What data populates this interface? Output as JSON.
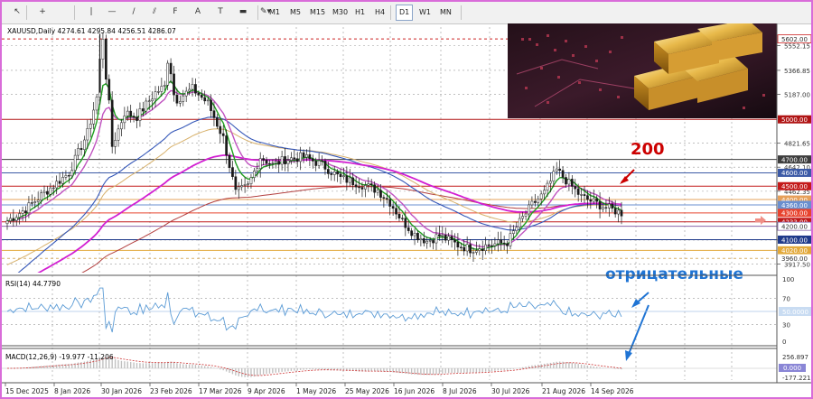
{
  "toolbar": {
    "tools": [
      {
        "name": "cursor",
        "glyph": "↖"
      },
      {
        "name": "crosshair",
        "glyph": "+"
      },
      {
        "name": "vertical-line",
        "glyph": "|"
      },
      {
        "name": "horizontal-line",
        "glyph": "—"
      },
      {
        "name": "trendline",
        "glyph": "/"
      },
      {
        "name": "equidistant-channel",
        "glyph": "⫽"
      },
      {
        "name": "fibonacci",
        "glyph": "F"
      },
      {
        "name": "text",
        "glyph": "A"
      },
      {
        "name": "text-label",
        "glyph": "T"
      },
      {
        "name": "rectangle",
        "glyph": "▬"
      },
      {
        "name": "shapes",
        "glyph": "✎▾"
      }
    ],
    "timeframes": [
      "M1",
      "M5",
      "M15",
      "M30",
      "H1",
      "H4",
      "D1",
      "W1",
      "MN"
    ],
    "active_timeframe": "D1"
  },
  "chart_info": {
    "symbol_line": "XAUUSD,Daily  4274.61 4295.84 4256.51 4286.07"
  },
  "annotations": {
    "ma_label": "200",
    "rsi_note": "отрицательные"
  },
  "price_axis": {
    "ticks": [
      "5552.15",
      "5366.85",
      "5187.00",
      "4821.65",
      "4642.10",
      "4462.35",
      "4097.40",
      "3917.50"
    ],
    "levels": [
      {
        "label": "5602.00",
        "bg": "#ffffff",
        "fg": "#333333",
        "border": "#cc2222",
        "price": 5602
      },
      {
        "label": "5000.00",
        "bg": "#b01414",
        "fg": "#ffffff",
        "price": 5000
      },
      {
        "label": "4700.00",
        "bg": "#3d3d3d",
        "fg": "#ffffff",
        "price": 4700
      },
      {
        "label": "4600.00",
        "bg": "#3c5aa6",
        "fg": "#ffffff",
        "price": 4600
      },
      {
        "label": "4500.00",
        "bg": "#c41a1a",
        "fg": "#ffffff",
        "price": 4500
      },
      {
        "label": "4400.00",
        "bg": "#e6a05a",
        "fg": "#ffffff",
        "price": 4400
      },
      {
        "label": "4360.00",
        "bg": "#6a8fcf",
        "fg": "#ffffff",
        "price": 4360
      },
      {
        "label": "4300.00",
        "bg": "#e8432e",
        "fg": "#ffffff",
        "price": 4300
      },
      {
        "label": "4233.00",
        "bg": "#c01818",
        "fg": "#ffffff",
        "price": 4233
      },
      {
        "label": "4200.00",
        "bg": "#ffffff",
        "fg": "#333333",
        "border": "#8866aa",
        "price": 4200
      },
      {
        "label": "4100.00",
        "bg": "#1f3a8a",
        "fg": "#ffffff",
        "price": 4100
      },
      {
        "label": "4020.00",
        "bg": "#e2a93b",
        "fg": "#ffffff",
        "price": 4020
      },
      {
        "label": "3960.00",
        "bg": "#ffffff",
        "fg": "#333333",
        "price": 3960
      }
    ]
  },
  "rsi": {
    "label": "RSI(14) 44.7790",
    "ticks": [
      "100",
      "70",
      "30",
      "0"
    ],
    "badge": "50.0000"
  },
  "macd": {
    "label": "MACD(12,26,9) -19.977 -11.206",
    "ticks": [
      "256.897",
      "-177.221"
    ],
    "badge": "0.000"
  },
  "time_axis": [
    "15 Dec 2025",
    "8 Jan 2026",
    "30 Jan 2026",
    "23 Feb 2026",
    "17 Mar 2026",
    "9 Apr 2026",
    "1 May 2026",
    "25 May 2026",
    "16 Jun 2026",
    "8 Jul 2026",
    "30 Jul 2026",
    "21 Aug 2026",
    "14 Sep 2026"
  ],
  "colors": {
    "grid": "#9a9a9a",
    "candle": "#1a1a1a",
    "green_ma": "#1f9e1f",
    "violet_ma": "#c052c0",
    "magenta_ma": "#d21fd2",
    "blue_ma": "#3557b8",
    "tan_ma": "#d7b06a",
    "red_ma": "#b34040",
    "rsi_line": "#5b9bd5",
    "annotation_red": "#cc0000",
    "annotation_blue": "#1f74d4"
  }
}
